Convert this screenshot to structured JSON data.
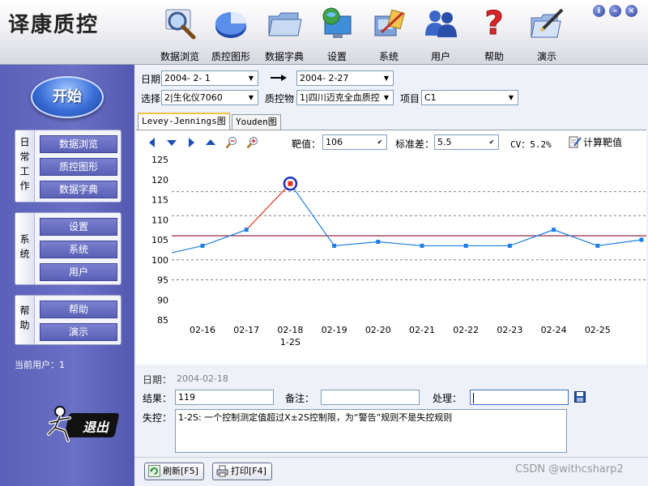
{
  "app": {
    "title": "译康质控"
  },
  "toolbar": {
    "items": [
      {
        "label": "数据浏览",
        "icon": "magnifier-icon"
      },
      {
        "label": "质控图形",
        "icon": "pie-chart-icon"
      },
      {
        "label": "数据字典",
        "icon": "folder-icon"
      },
      {
        "label": "设置",
        "icon": "monitor-globe-icon"
      },
      {
        "label": "系统",
        "icon": "system-tools-icon"
      },
      {
        "label": "用户",
        "icon": "users-icon"
      },
      {
        "label": "帮助",
        "icon": "question-mark-icon"
      },
      {
        "label": "演示",
        "icon": "folder-pen-icon"
      }
    ]
  },
  "window_controls": {
    "info": "i",
    "minimize": "–",
    "close": "×"
  },
  "sidebar": {
    "start_label": "开始",
    "groups": [
      {
        "title": "日常工作",
        "items": [
          "数据浏览",
          "质控图形",
          "数据字典"
        ]
      },
      {
        "title": "系统",
        "items": [
          "设置",
          "系统",
          "用户"
        ]
      },
      {
        "title": "帮助",
        "items": [
          "帮助",
          "演示"
        ]
      }
    ],
    "current_user": "当前用户：1",
    "logout_label": "退出"
  },
  "filters": {
    "date_label": "日期",
    "date_from": "2004- 2- 1",
    "date_to": "2004- 2-27",
    "select_label": "选择",
    "instrument": "2|生化仪7060",
    "control_label": "质控物",
    "control": "1|四川迈克全血质控",
    "item_label": "项目",
    "item": "C1"
  },
  "tabs": [
    "Levey-Jennings图",
    "Youden图"
  ],
  "chart_toolbar": {
    "target_label": "靶值：",
    "target_value": "106",
    "sd_label": "标准差：",
    "sd_value": "5.5",
    "cv_text": "CV：5.2%",
    "calc_label": "计算靶值"
  },
  "chart_data": {
    "type": "line",
    "title": "",
    "xlabel": "",
    "ylabel": "",
    "ylim": [
      85,
      125
    ],
    "yticks": [
      85,
      90,
      95,
      100,
      105,
      110,
      115,
      120,
      125
    ],
    "x_ticks": [
      "02-16",
      "02-17",
      "02-18",
      "02-19",
      "02-20",
      "02-21",
      "02-22",
      "02-23",
      "02-24",
      "02-25"
    ],
    "x_tick_extra": {
      "02-18": "1-2S"
    },
    "points": [
      {
        "x": "02-15",
        "y": 101
      },
      {
        "x": "02-16",
        "y": 103.5
      },
      {
        "x": "02-17",
        "y": 107.5
      },
      {
        "x": "02-18",
        "y": 119,
        "flag": "1-2S"
      },
      {
        "x": "02-19",
        "y": 103.5
      },
      {
        "x": "02-20",
        "y": 104.5
      },
      {
        "x": "02-21",
        "y": 103.5
      },
      {
        "x": "02-22",
        "y": 103.5
      },
      {
        "x": "02-23",
        "y": 103.5
      },
      {
        "x": "02-24",
        "y": 107.5
      },
      {
        "x": "02-25",
        "y": 103.5
      },
      {
        "x": "02-26",
        "y": 105
      }
    ],
    "mean": 106,
    "dashed_lines": [
      95,
      100,
      111,
      117
    ],
    "colors": {
      "line": "#1e7fe0",
      "violation": "#e8301c",
      "mean": "#8a1530",
      "dashed": "#808080",
      "flag_ring": "#1c2fbf"
    }
  },
  "detail": {
    "date_label": "日期：",
    "date_value": "2004-02-18",
    "result_label": "结果：",
    "result_value": "119",
    "remark_label": "备注：",
    "remark_value": "",
    "handling_label": "处理：",
    "handling_value": "",
    "control_label": "失控：",
    "control_text": "1-2S:  一个控制测定值超过X±2S控制限，为“警告”规则不是失控规则"
  },
  "buttons": {
    "refresh": "刷新[F5]",
    "print": "打印[F4]"
  },
  "watermark": "CSDN @withcsharp2"
}
